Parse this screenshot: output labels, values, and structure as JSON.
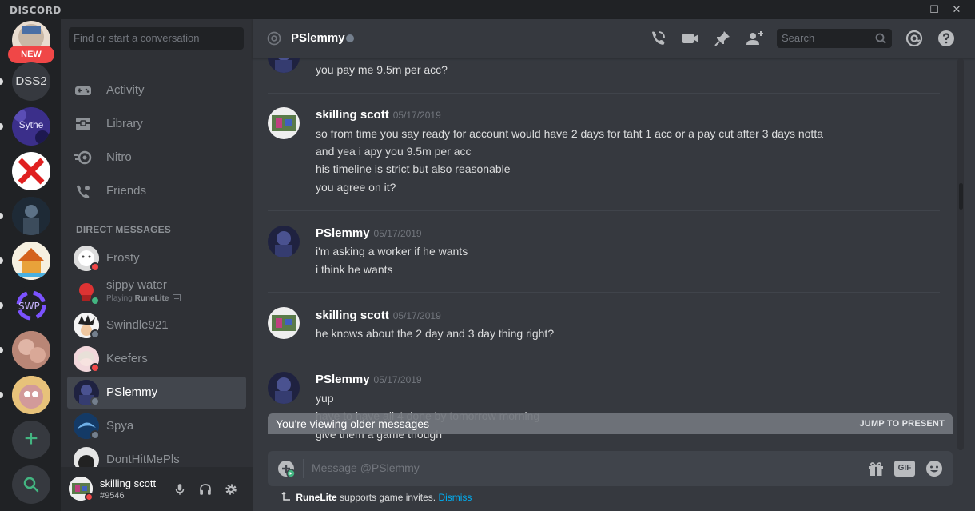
{
  "titlebar": {
    "app_name": "DISCORD",
    "minimize": "—",
    "maximize": "☐",
    "close": "✕"
  },
  "servers": {
    "new_badge": "NEW",
    "dss2_label": "DSS2",
    "sythe_label": "Sythe",
    "add_server": "+",
    "explore": "search"
  },
  "sidebar": {
    "search_placeholder": "Find or start a conversation",
    "nav": [
      {
        "label": "Activity",
        "icon": "gamepad-icon"
      },
      {
        "label": "Library",
        "icon": "library-icon"
      },
      {
        "label": "Nitro",
        "icon": "nitro-icon"
      },
      {
        "label": "Friends",
        "icon": "friends-icon"
      }
    ],
    "dm_header": "DIRECT MESSAGES",
    "dms": [
      {
        "name": "Frosty",
        "status": "dnd"
      },
      {
        "name": "sippy water",
        "status": "online",
        "activity_prefix": "Playing",
        "activity_game": "RuneLite"
      },
      {
        "name": "Swindle921",
        "status": "offline"
      },
      {
        "name": "Keefers",
        "status": "dnd"
      },
      {
        "name": "PSlemmy",
        "status": "offline",
        "active": true
      },
      {
        "name": "Spya",
        "status": "offline"
      },
      {
        "name": "DontHitMePls",
        "status": "offline"
      }
    ]
  },
  "user": {
    "name": "skilling scott",
    "tag": "#9546",
    "status": "dnd"
  },
  "chat": {
    "channel_name": "PSlemmy",
    "search_placeholder": "Search",
    "messages": [
      {
        "lines": [
          "you pay me 9.5m per acc?"
        ]
      },
      {
        "author": "skilling scott",
        "timestamp": "05/17/2019",
        "lines": [
          "so from time you say ready for account would have 2 days for taht 1 acc or a pay cut after 3 days notta",
          "and yea i apy you 9.5m per acc",
          "his timeline is strict but also reasonable",
          "you agree on it?"
        ]
      },
      {
        "author": "PSlemmy",
        "timestamp": "05/17/2019",
        "lines": [
          "i'm asking a worker if he wants",
          "i think he wants"
        ]
      },
      {
        "author": "skilling scott",
        "timestamp": "05/17/2019",
        "lines": [
          "he knows about the 2 day and 3 day thing right?"
        ]
      },
      {
        "author": "PSlemmy",
        "timestamp": "05/17/2019",
        "lines": [
          "yup",
          "have to have all 4 done by tomorrow morning",
          "give them a game though"
        ]
      }
    ],
    "older_notice": "You're viewing older messages",
    "jump_label": "JUMP TO PRESENT",
    "composer_placeholder": "Message @PSlemmy",
    "gif_label": "GIF",
    "invite_game": "RuneLite",
    "invite_text": "supports game invites.",
    "invite_dismiss": "Dismiss"
  },
  "colors": {
    "bg_dark": "#202225",
    "sidebar": "#2f3136",
    "chat": "#36393f",
    "online": "#43b581",
    "dnd": "#f04747",
    "offline": "#747f8d",
    "link": "#00b0f4"
  }
}
